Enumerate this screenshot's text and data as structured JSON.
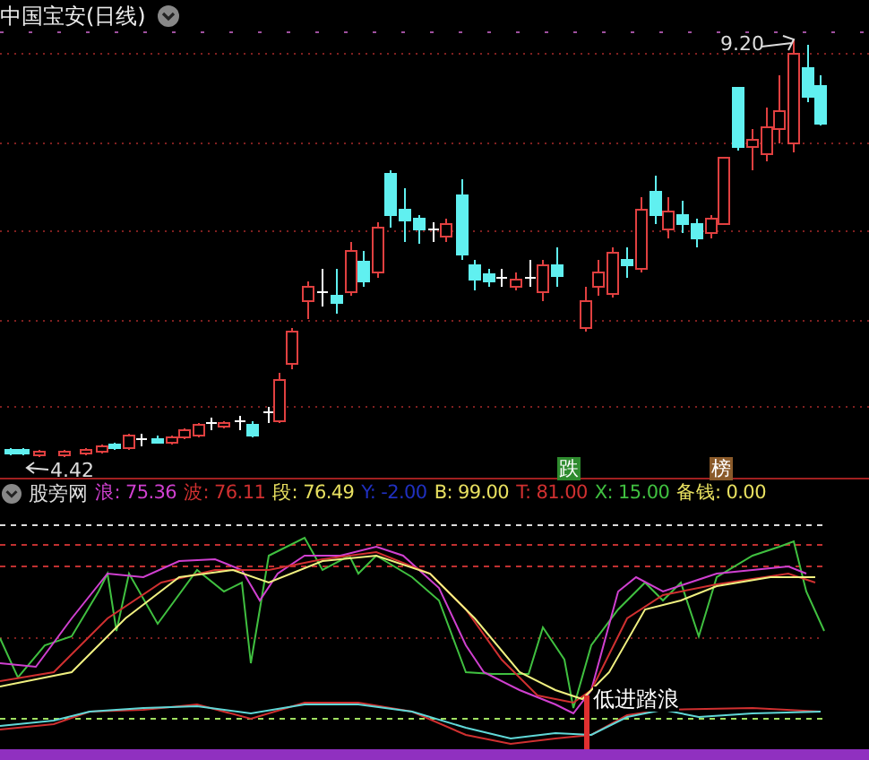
{
  "chart": {
    "title": "中国宝安(日线)",
    "high_label": "9.20",
    "low_label": "4.42",
    "signals": [
      {
        "text": "跌",
        "color": "#2e8b2e"
      },
      {
        "text": "榜",
        "color": "#8a5a2a"
      }
    ]
  },
  "indicator": {
    "name": "股旁网",
    "values": [
      {
        "text": "浪: 75.36",
        "color": "#d040d0"
      },
      {
        "text": "波: 76.11",
        "color": "#d03030"
      },
      {
        "text": "段: 76.49",
        "color": "#e8e060"
      },
      {
        "text": "Y: -2.00",
        "color": "#2030c0"
      },
      {
        "text": "B: 99.00",
        "color": "#e8e060"
      },
      {
        "text": "T: 81.00",
        "color": "#d03030"
      },
      {
        "text": "X: 15.00",
        "color": "#40c040"
      },
      {
        "text": "备钱: 0.00",
        "color": "#e8e060"
      }
    ],
    "annotation": "低进踏浪"
  }
}
